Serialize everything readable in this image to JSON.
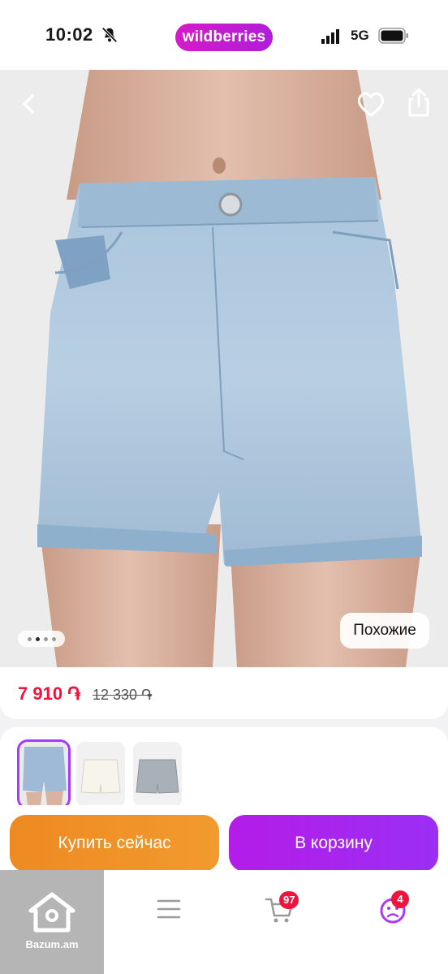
{
  "status_bar": {
    "time": "10:02",
    "app_pill": "wildberries",
    "network": "5G"
  },
  "image": {
    "similar_label": "Похожие",
    "carousel_dots": 4,
    "active_dot": 1
  },
  "price": {
    "current": "7 910 ֏",
    "old": "12 330 ֏"
  },
  "variants": [
    {
      "name": "light-blue-denim",
      "selected": true
    },
    {
      "name": "white-denim",
      "selected": false
    },
    {
      "name": "grey-denim",
      "selected": false
    }
  ],
  "actions": {
    "buy_now": "Купить сейчас",
    "to_cart": "В корзину"
  },
  "nav": {
    "cart_badge": "97",
    "profile_badge": "4"
  },
  "watermark": {
    "text": "Bazum.am"
  },
  "colors": {
    "brand_purple": "#a73afd",
    "price_red": "#f0133b",
    "buy_orange": "#f08a24"
  }
}
